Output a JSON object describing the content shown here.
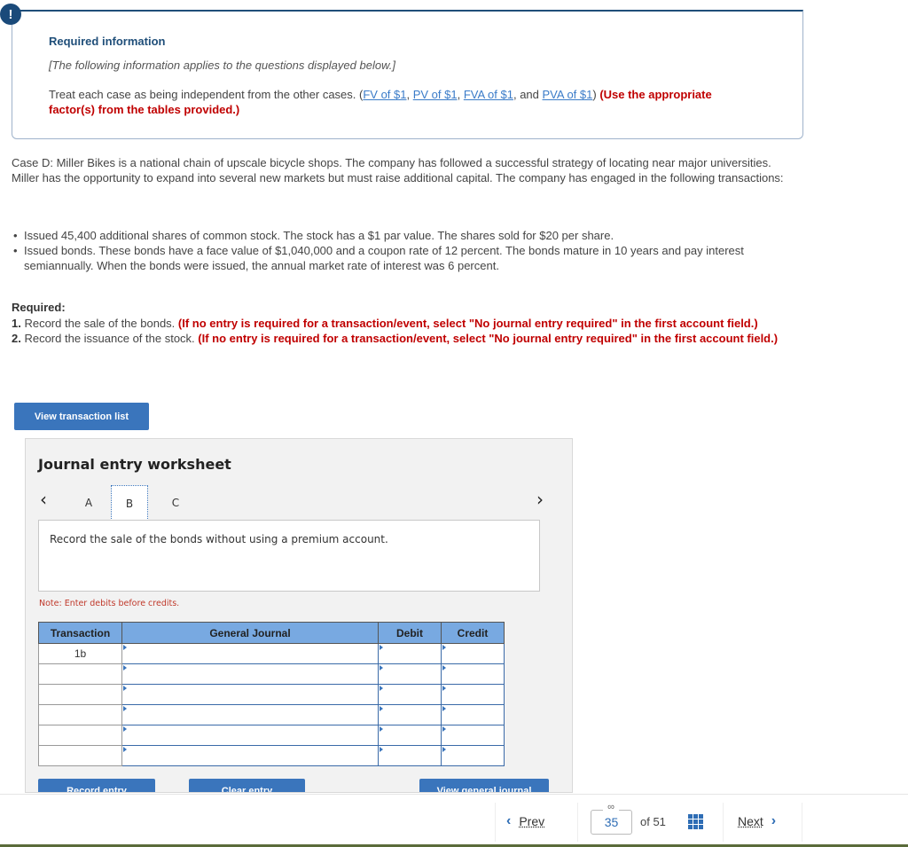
{
  "info": {
    "title": "Required information",
    "italic": "[The following information applies to the questions displayed below.]",
    "intro": "Treat each case as being independent from the other cases. (",
    "links": [
      "FV of $1",
      "PV of $1",
      "FVA of $1",
      "PVA of $1"
    ],
    "sep1": ", ",
    "sep2": ", ",
    "sep3": ", and ",
    "close": ") ",
    "instruction": "(Use the appropriate factor(s) from the tables provided.)"
  },
  "case_text": "Case D: Miller Bikes is a national chain of upscale bicycle shops. The company has followed a successful strategy of locating near major universities. Miller has the opportunity to expand into several new markets but must raise additional capital. The company has engaged in the following transactions:",
  "transactions": [
    "Issued 45,400 additional shares of common stock. The stock has a $1 par value. The shares sold for $20 per share.",
    "Issued bonds. These bonds have a face value of $1,040,000 and a coupon rate of 12 percent. The bonds mature in 10 years and pay interest semiannually. When the bonds were issued, the annual market rate of interest was 6 percent."
  ],
  "required": {
    "heading": "Required:",
    "items": [
      {
        "num": "1.",
        "text": " Record the sale of the bonds. ",
        "note": "(If no entry is required for a transaction/event, select \"No journal entry required\" in the first account field.)"
      },
      {
        "num": "2.",
        "text": " Record the issuance of the stock. ",
        "note": "(If no entry is required for a transaction/event, select \"No journal entry required\" in the first account field.)"
      }
    ]
  },
  "buttons": {
    "view_transaction_list": "View transaction list",
    "record_entry": "Record entry",
    "clear_entry": "Clear entry",
    "view_general_journal": "View general journal"
  },
  "worksheet": {
    "title": "Journal entry worksheet",
    "tabs": [
      "A",
      "B",
      "C"
    ],
    "active_tab": "B",
    "prev_icon": "‹",
    "next_icon": "›",
    "description": "Record the sale of the bonds without using a premium account.",
    "note": "Note: Enter debits before credits.",
    "columns": [
      "Transaction",
      "General Journal",
      "Debit",
      "Credit"
    ],
    "rows": [
      {
        "transaction": "1b",
        "account": "",
        "debit": "",
        "credit": ""
      },
      {
        "transaction": "",
        "account": "",
        "debit": "",
        "credit": ""
      },
      {
        "transaction": "",
        "account": "",
        "debit": "",
        "credit": ""
      },
      {
        "transaction": "",
        "account": "",
        "debit": "",
        "credit": ""
      },
      {
        "transaction": "",
        "account": "",
        "debit": "",
        "credit": ""
      },
      {
        "transaction": "",
        "account": "",
        "debit": "",
        "credit": ""
      }
    ]
  },
  "pagination": {
    "prev_label": "Prev",
    "next_label": "Next",
    "current_page": "35",
    "of_label": "of 51"
  }
}
